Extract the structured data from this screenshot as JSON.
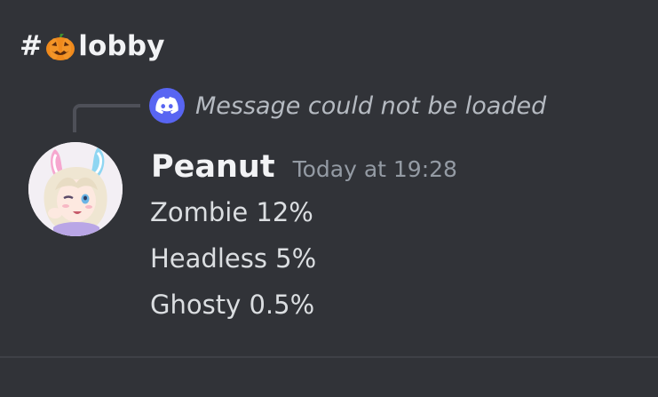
{
  "channel": {
    "hash": "#",
    "emoji_icon": "jack-o-lantern-icon",
    "name": "lobby"
  },
  "reply": {
    "icon": "discord-logo-icon",
    "text": "Message could not be loaded"
  },
  "message": {
    "author": "Peanut",
    "avatar": "anime-girl-avatar",
    "timestamp": "Today at 19:28",
    "lines": [
      "Zombie 12%",
      "Headless 5%",
      "Ghosty 0.5%"
    ]
  },
  "colors": {
    "background": "#313338",
    "blurple": "#5865f2",
    "muted_text": "#949ba4",
    "body_text": "#dbdee1"
  }
}
